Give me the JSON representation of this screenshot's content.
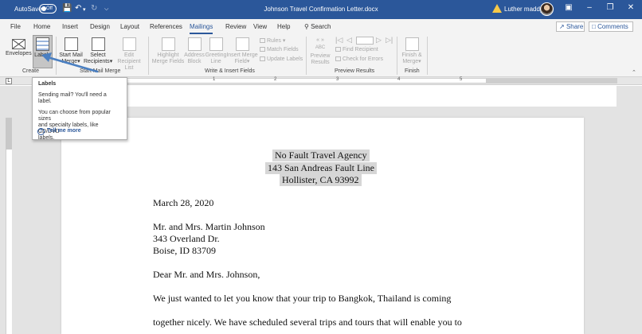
{
  "titlebar": {
    "autosave_label": "AutoSave",
    "autosave_state": "Off",
    "document_title": "Johnson Travel Confirmation Letter.docx",
    "user_name": "Luther maddy",
    "color": "#2b579a"
  },
  "tabs": [
    "File",
    "Home",
    "Insert",
    "Design",
    "Layout",
    "References",
    "Mailings",
    "Review",
    "View",
    "Help"
  ],
  "active_tab": "Mailings",
  "search_label": "Search",
  "share_label": "Share",
  "comments_label": "Comments",
  "ribbon": {
    "create": {
      "group_label": "Create",
      "envelopes": "Envelopes",
      "labels": "Labels"
    },
    "start_mail_merge": {
      "group_label": "Start Mail Merge",
      "start_mail_merge_1": "Start Mail",
      "start_mail_merge_2": "Merge",
      "select_recipients_1": "Select",
      "select_recipients_2": "Recipients",
      "edit_recipient_1": "Edit",
      "edit_recipient_2": "Recipient List"
    },
    "write_insert": {
      "group_label": "Write & Insert Fields",
      "highlight_1": "Highlight",
      "highlight_2": "Merge Fields",
      "address_1": "Address",
      "address_2": "Block",
      "greeting_1": "Greeting",
      "greeting_2": "Line",
      "insert_merge_1": "Insert Merge",
      "insert_merge_2": "Field",
      "rules": "Rules",
      "match_fields": "Match Fields",
      "update_labels": "Update Labels"
    },
    "preview": {
      "group_label": "Preview Results",
      "abc": "ABC",
      "preview_1": "Preview",
      "preview_2": "Results",
      "find_recipient": "Find Recipient",
      "check_errors": "Check for Errors"
    },
    "finish": {
      "group_label": "Finish",
      "finish_1": "Finish &",
      "finish_2": "Merge"
    }
  },
  "ruler_numbers": [
    "1",
    "2",
    "3",
    "4",
    "5"
  ],
  "tooltip": {
    "title": "Labels",
    "line1": "Sending mail? You'll need a label.",
    "line2": "You can choose from popular sizes",
    "line3": "and specialty labels, like CD/DVD",
    "line4": "labels.",
    "tell_more": "Tell me more"
  },
  "document": {
    "agency_name": "No Fault Travel Agency",
    "agency_street": "143 San Andreas Fault Line",
    "agency_city": "Hollister, CA  93992",
    "date": "March 28, 2020",
    "recipient_name": "Mr. and Mrs. Martin Johnson",
    "recipient_street": "343 Overland Dr.",
    "recipient_city": "Boise, ID  83709",
    "salutation": "Dear Mr. and Mrs. Johnson,",
    "body_line1": "We just wanted to let you know that your trip to Bangkok, Thailand is coming",
    "body_line2": "together nicely.  We have scheduled several trips and tours that will enable you to"
  },
  "colors": {
    "accent": "#2b579a",
    "arrow": "#4a7fc1",
    "selection_highlight": "#d6d6d6"
  }
}
